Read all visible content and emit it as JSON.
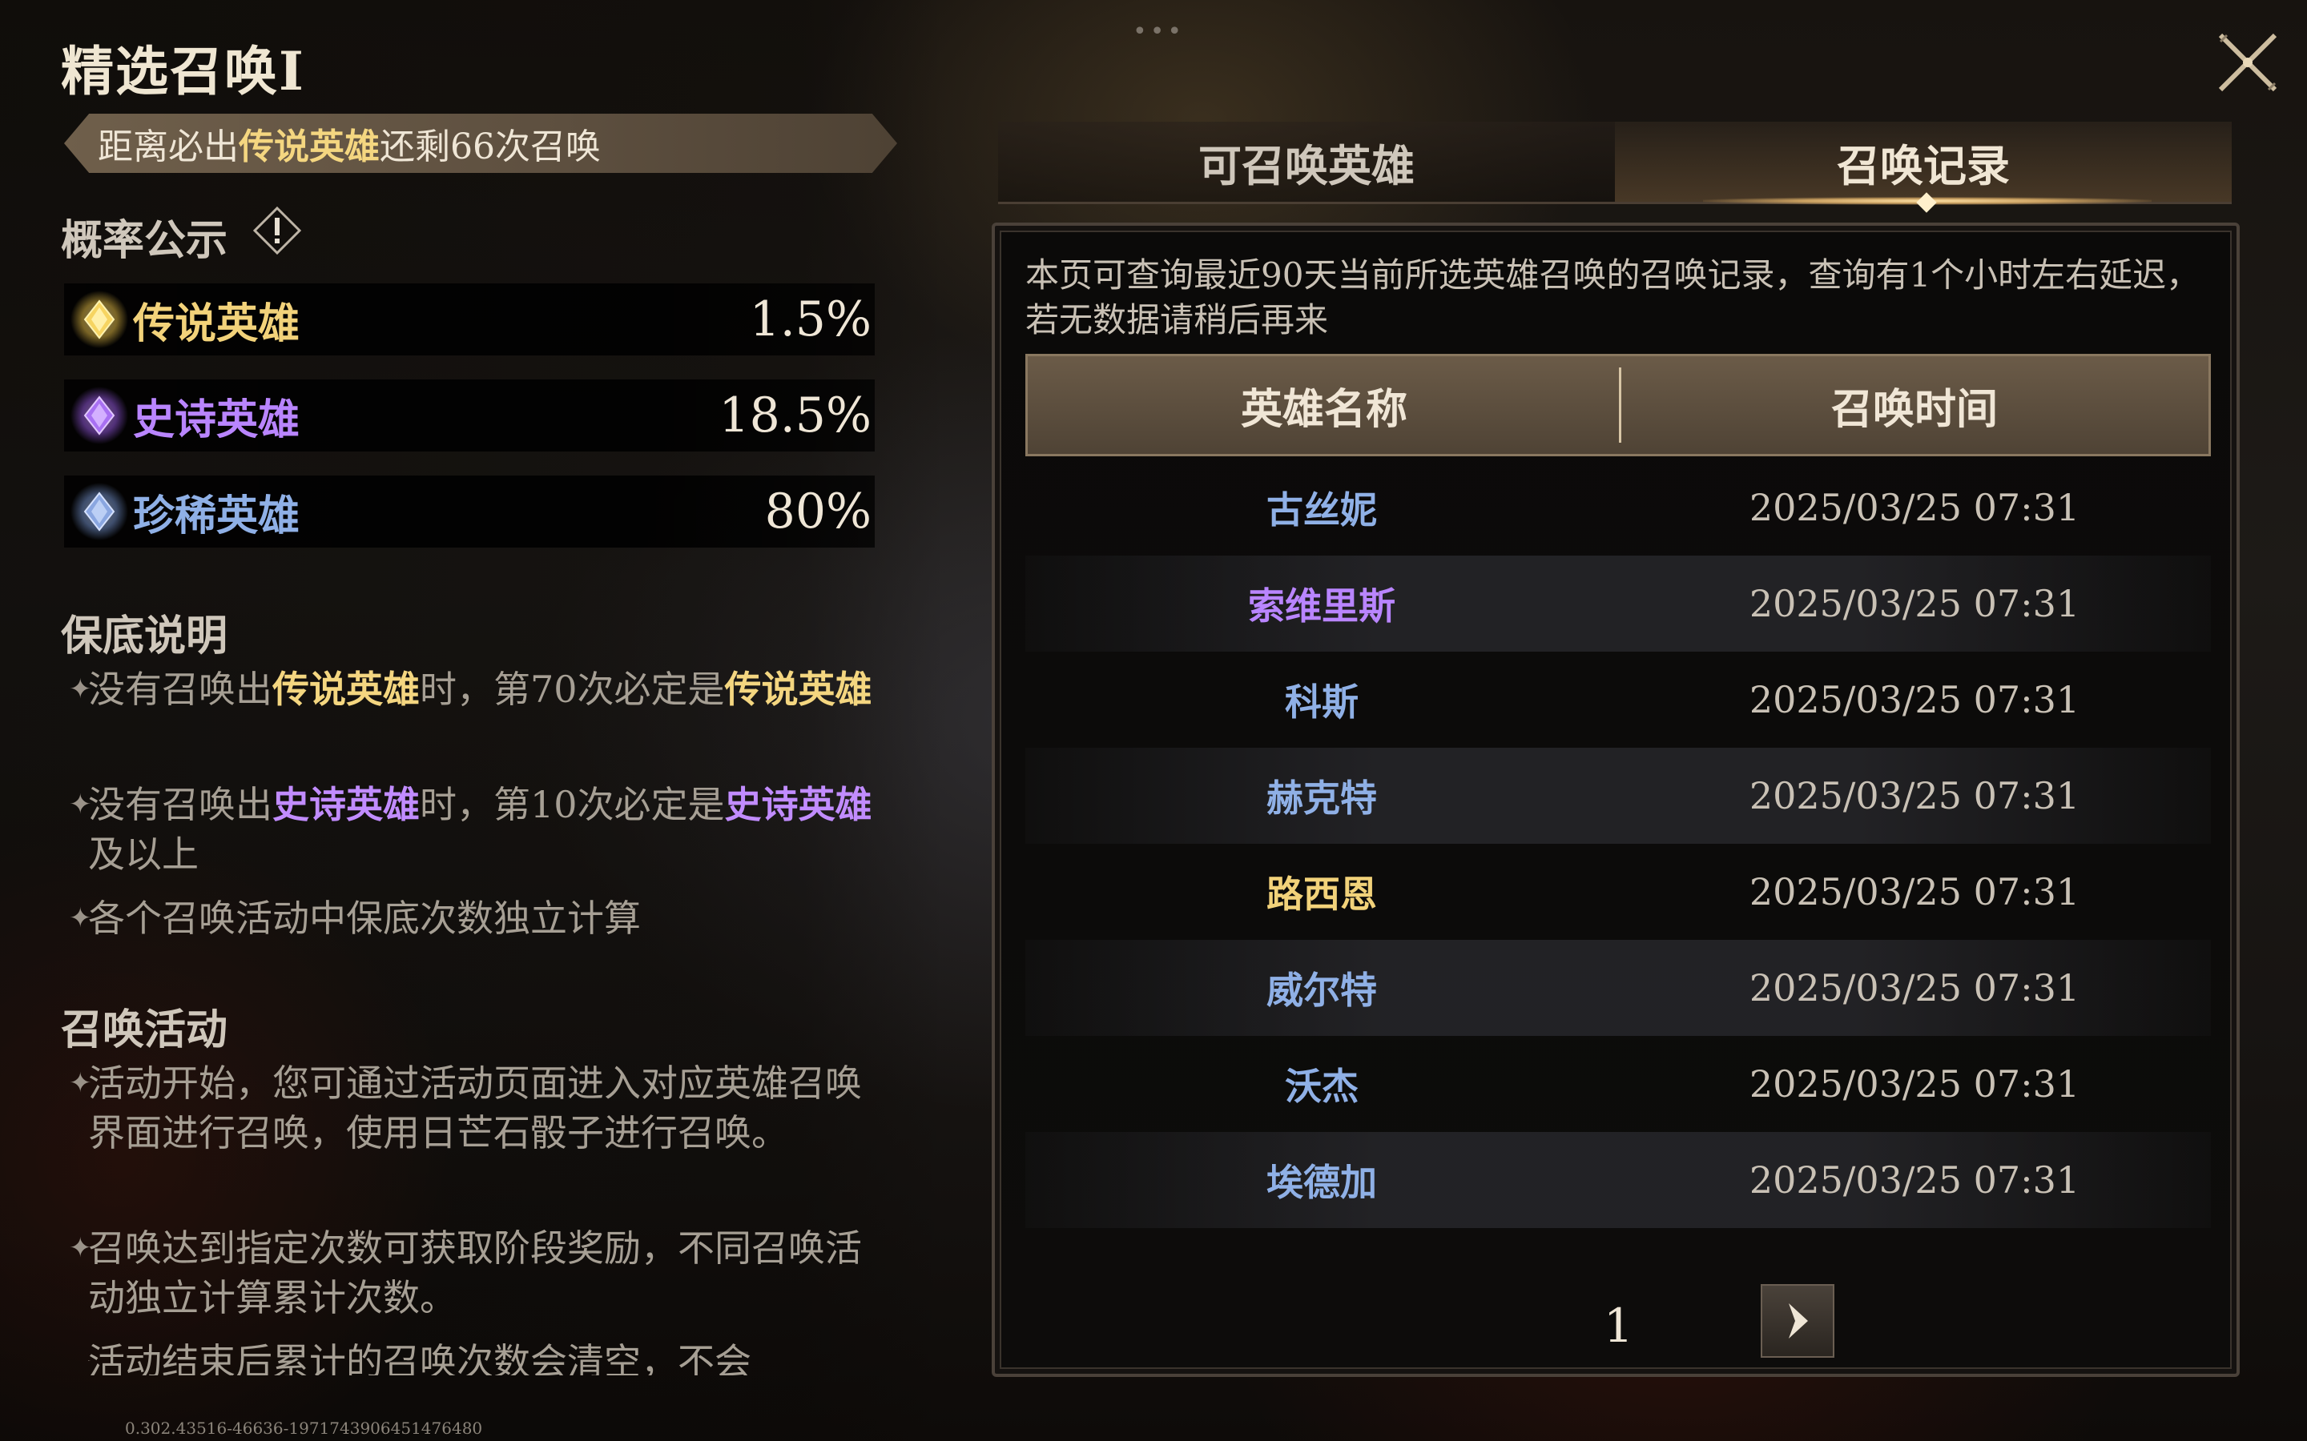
{
  "left": {
    "title": "精选召唤I",
    "pity": {
      "prefix": "距离必出",
      "highlight": "传说英雄",
      "suffix": "还剩66次召唤"
    },
    "rates_heading": "概率公示",
    "rates": [
      {
        "label": "传说英雄",
        "value": "1.5%",
        "color": "#f2d27a"
      },
      {
        "label": "史诗英雄",
        "value": "18.5%",
        "color": "#b985ff"
      },
      {
        "label": "珍稀英雄",
        "value": "80%",
        "color": "#8fb0e6"
      }
    ],
    "guarantee_heading": "保底说明",
    "guarantee": [
      {
        "a": "没有召唤出",
        "b": "传说英雄",
        "c": "时，第70次必定是",
        "d": "传说英雄",
        "e": ""
      },
      {
        "a": "没有召唤出",
        "b": "史诗英雄",
        "c": "时，第10次必定是",
        "d": "史诗英雄",
        "e": "及以上"
      },
      {
        "a": "各个召唤活动中保底次数独立计算"
      }
    ],
    "activity_heading": "召唤活动",
    "activity": [
      "活动开始，您可通过活动页面进入对应英雄召唤界面进行召唤，使用日芒石骰子进行召唤。",
      "召唤达到指定次数可获取阶段奖励，不同召唤活动独立计算累计次数。",
      "活动结束后累计的召唤次数会清空，不会"
    ],
    "uid": "0.302.43516-46636-1971743906451476480"
  },
  "tabs": {
    "available": "可召唤英雄",
    "record": "召唤记录"
  },
  "record": {
    "note": "本页可查询最近90天当前所选英雄召唤的召唤记录，查询有1个小时左右延迟，若无数据请稍后再来",
    "col_name": "英雄名称",
    "col_time": "召唤时间",
    "rows": [
      {
        "name": "古丝妮",
        "time": "2025/03/25 07:31",
        "color": "#8fb0e6"
      },
      {
        "name": "索维里斯",
        "time": "2025/03/25 07:31",
        "color": "#b985ff"
      },
      {
        "name": "科斯",
        "time": "2025/03/25 07:31",
        "color": "#8fb0e6"
      },
      {
        "name": "赫克特",
        "time": "2025/03/25 07:31",
        "color": "#8fb0e6"
      },
      {
        "name": "路西恩",
        "time": "2025/03/25 07:31",
        "color": "#f2d27a"
      },
      {
        "name": "威尔特",
        "time": "2025/03/25 07:31",
        "color": "#8fb0e6"
      },
      {
        "name": "沃杰",
        "time": "2025/03/25 07:31",
        "color": "#8fb0e6"
      },
      {
        "name": "埃德加",
        "time": "2025/03/25 07:31",
        "color": "#8fb0e6"
      }
    ],
    "page": "1"
  },
  "icons": {
    "close": "close-icon",
    "next": "chevron-right-icon",
    "info": "exclamation-icon",
    "gem": "diamond-gem-icon"
  }
}
